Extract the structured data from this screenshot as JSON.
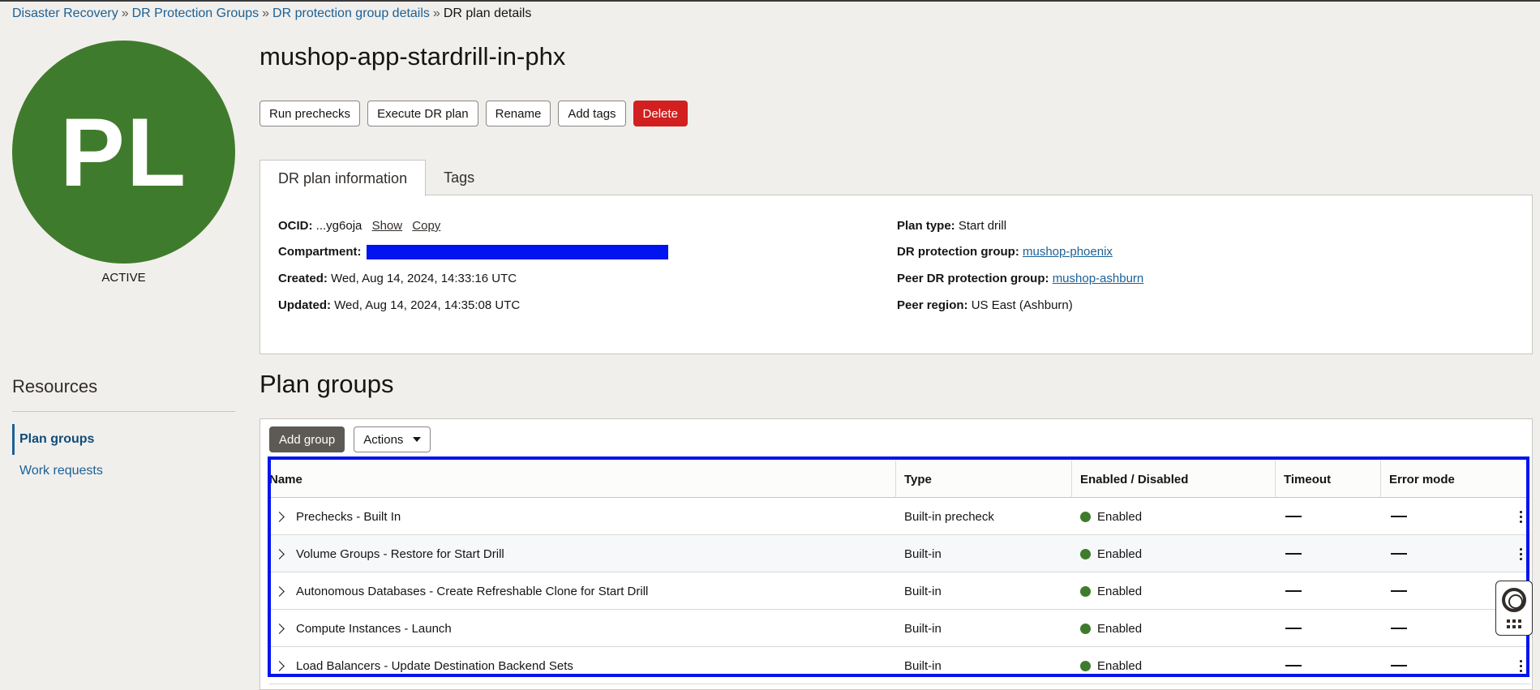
{
  "breadcrumb": {
    "items": [
      "Disaster Recovery",
      "DR Protection Groups",
      "DR protection group details"
    ],
    "current": "DR plan details",
    "separator": "»"
  },
  "avatar": {
    "initials": "PL",
    "status": "ACTIVE",
    "color": "#3f7b2c"
  },
  "page": {
    "title": "mushop-app-stardrill-in-phx"
  },
  "actions": {
    "run_prechecks": "Run prechecks",
    "execute": "Execute DR plan",
    "rename": "Rename",
    "add_tags": "Add tags",
    "delete": "Delete"
  },
  "tabs": [
    "DR plan information",
    "Tags"
  ],
  "info": {
    "ocid_label": "OCID:",
    "ocid_value": "...yg6oja",
    "show": "Show",
    "copy": "Copy",
    "compartment_label": "Compartment:",
    "created_label": "Created:",
    "created_value": "Wed, Aug 14, 2024, 14:33:16 UTC",
    "updated_label": "Updated:",
    "updated_value": "Wed, Aug 14, 2024, 14:35:08 UTC",
    "plan_type_label": "Plan type:",
    "plan_type_value": "Start drill",
    "dr_group_label": "DR protection group:",
    "dr_group_value": "mushop-phoenix",
    "peer_group_label": "Peer DR protection group:",
    "peer_group_value": "mushop-ashburn",
    "peer_region_label": "Peer region:",
    "peer_region_value": "US East (Ashburn)"
  },
  "resources": {
    "title": "Resources",
    "items": [
      "Plan groups",
      "Work requests"
    ]
  },
  "plan_groups": {
    "title": "Plan groups",
    "add_group": "Add group",
    "actions": "Actions",
    "columns": [
      "Name",
      "Type",
      "Enabled / Disabled",
      "Timeout",
      "Error mode"
    ],
    "rows": [
      {
        "name": "Prechecks - Built In",
        "type": "Built-in precheck",
        "status": "Enabled"
      },
      {
        "name": "Volume Groups - Restore for Start Drill",
        "type": "Built-in",
        "status": "Enabled"
      },
      {
        "name": "Autonomous Databases - Create Refreshable Clone for Start Drill",
        "type": "Built-in",
        "status": "Enabled"
      },
      {
        "name": "Compute Instances - Launch",
        "type": "Built-in",
        "status": "Enabled"
      },
      {
        "name": "Load Balancers - Update Destination Backend Sets",
        "type": "Built-in",
        "status": "Enabled"
      }
    ]
  },
  "colors": {
    "link": "#1b6196",
    "danger": "#d1201f",
    "enabled": "#3f7b2c",
    "highlight": "#0014ef"
  }
}
